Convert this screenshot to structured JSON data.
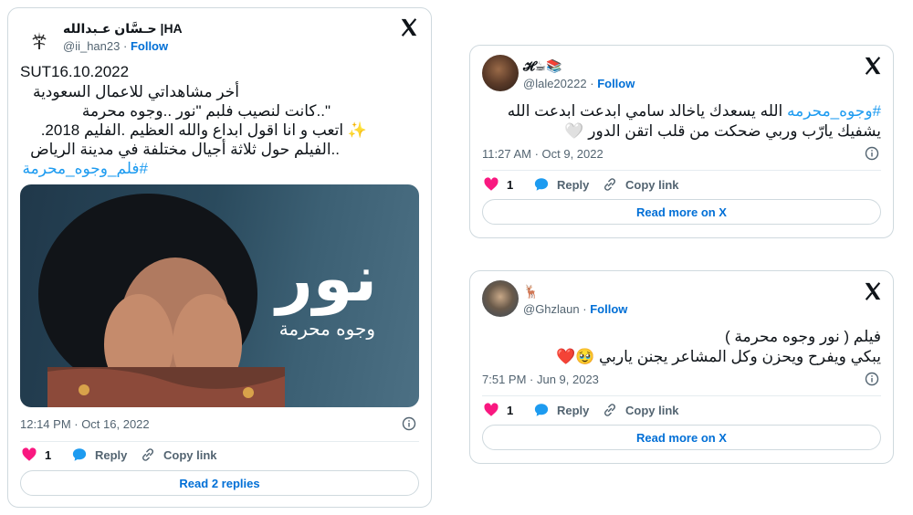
{
  "tweets": [
    {
      "name": "حـسَّان عـبدالله |HA",
      "handle": "@ii_han23",
      "separator": "·",
      "follow": "Follow",
      "lines": [
        "SUT16.10.2022",
        "أخر مشاهداتي  للاعمال السعودية",
        "\"..كانت لنصيب  فلبم \"نور ..وجوه محرمة",
        "✨ اتعب و انا اقول ابداع والله العظيم .الفليم 2018.",
        "..الفيلم حول ثلاثة أجيال مختلفة في مدينة الرياض"
      ],
      "hashtag": "#فلم_وجوه_محرمة",
      "media": {
        "title": "نور",
        "subtitle": "وجوه محرمة"
      },
      "time": "12:14 PM · Oct 16, 2022",
      "likes": "1",
      "reply": "Reply",
      "copy": "Copy link",
      "pill": "Read 2 replies"
    },
    {
      "name": "𝓗☕📚",
      "handle": "@lale20222",
      "separator": "·",
      "follow": "Follow",
      "hashtag": "#وجوه_محرمه",
      "line1_text": " الله يسعدك ياخالد سامي ابدعت ابدعت الله",
      "line2": "يشفيك يارّب  وربي ضحكت من قلب اتقن الدور 🤍",
      "time": "11:27 AM · Oct 9, 2022",
      "likes": "1",
      "reply": "Reply",
      "copy": "Copy link",
      "pill": "Read more on X"
    },
    {
      "name": "🦌",
      "handle": "@Ghzlaun",
      "separator": "·",
      "follow": "Follow",
      "line1": "فيلم ( نور وجوه محرمة )",
      "line2": "يبكي ويفرح ويحزن وكل المشاعر يجنن ياربي 🥹❤️",
      "time": "7:51 PM · Jun 9, 2023",
      "likes": "1",
      "reply": "Reply",
      "copy": "Copy link",
      "pill": "Read more on X"
    }
  ],
  "colors": {
    "link": "#006fd6",
    "hashtag": "#1d9bf0",
    "like": "#f91880",
    "reply": "#1d9bf0",
    "muted": "#536471"
  },
  "icons": [
    "x-logo-icon",
    "heart-icon",
    "reply-bubble-icon",
    "link-icon",
    "info-icon"
  ]
}
